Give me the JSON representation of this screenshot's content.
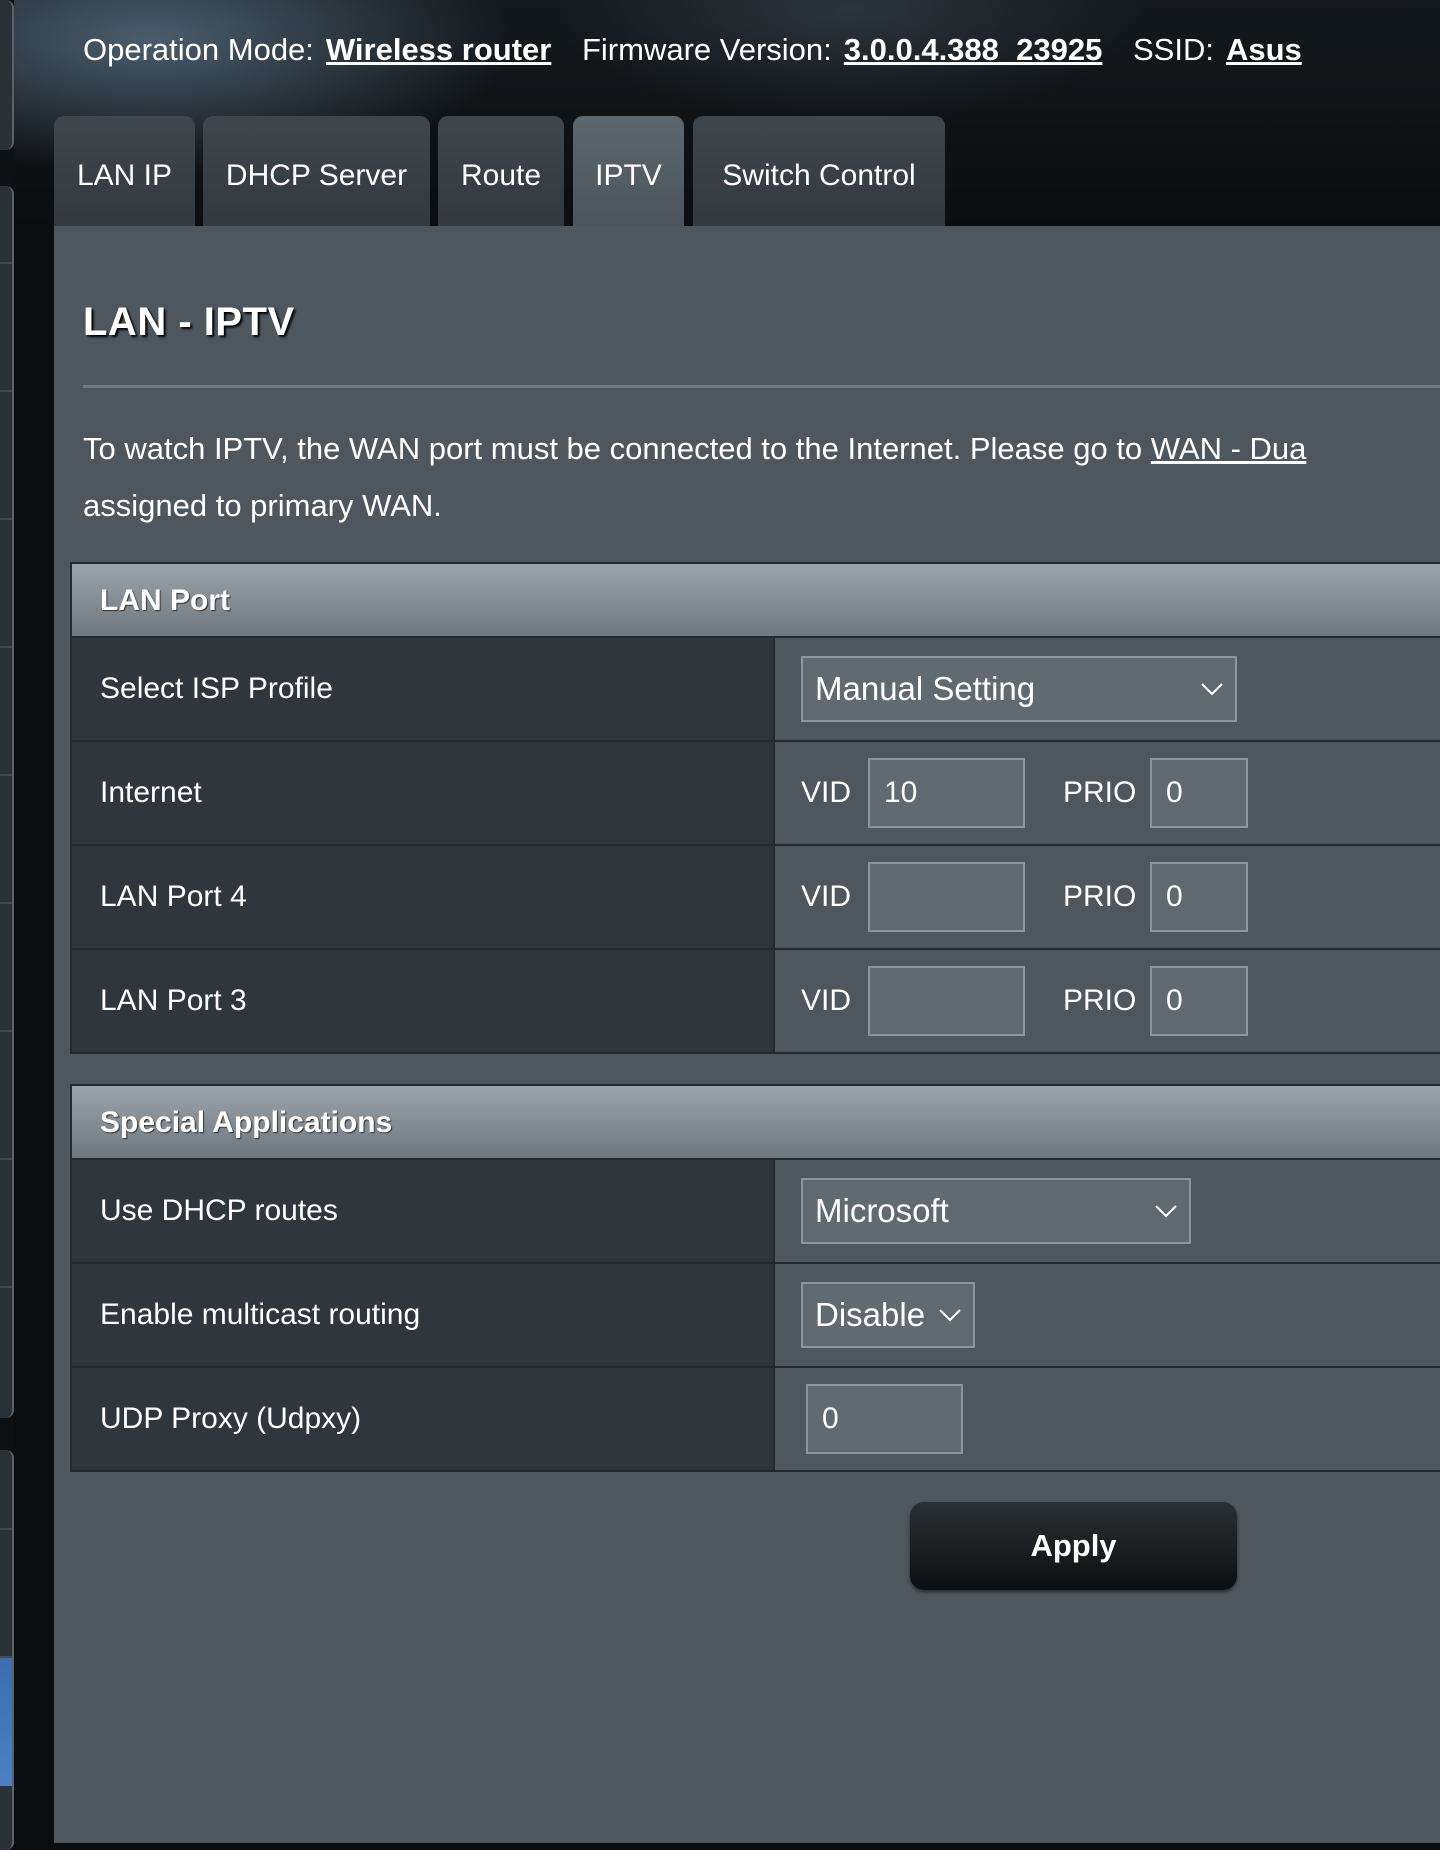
{
  "info_bar": {
    "operation_mode_label": "Operation Mode:",
    "operation_mode_value": "Wireless router",
    "firmware_label": "Firmware Version:",
    "firmware_value": "3.0.0.4.388_23925",
    "ssid_label": "SSID:",
    "ssid_value": "Asus"
  },
  "tabs": [
    {
      "label": "LAN IP",
      "active": false
    },
    {
      "label": "DHCP Server",
      "active": false
    },
    {
      "label": "Route",
      "active": false
    },
    {
      "label": "IPTV",
      "active": true
    },
    {
      "label": "Switch Control",
      "active": false
    }
  ],
  "page": {
    "title": "LAN - IPTV",
    "desc_line1_prefix": "To watch IPTV, the WAN port must be connected to the Internet. Please go to ",
    "desc_link": "WAN - Dua",
    "desc_line2": "assigned to primary WAN."
  },
  "lan_port": {
    "header": "LAN Port",
    "isp_profile_label": "Select ISP Profile",
    "isp_profile_value": "Manual Setting",
    "vid_label": "VID",
    "prio_label": "PRIO",
    "rows": [
      {
        "label": "Internet",
        "vid": "10",
        "prio": "0"
      },
      {
        "label": "LAN Port 4",
        "vid": "",
        "prio": "0"
      },
      {
        "label": "LAN Port 3",
        "vid": "",
        "prio": "0"
      }
    ]
  },
  "special": {
    "header": "Special Applications",
    "dhcp_routes_label": "Use DHCP routes",
    "dhcp_routes_value": "Microsoft",
    "multicast_label": "Enable multicast routing",
    "multicast_value": "Disable",
    "udpxy_label": "UDP Proxy (Udpxy)",
    "udpxy_value": "0"
  },
  "apply_label": "Apply",
  "colors": {
    "panel": "#4d575d",
    "label_cell": "#2f373c",
    "input_bg": "#5f6b71",
    "sidebar_accent": "#4d7fc4"
  },
  "icons": {
    "select_arrow": "chevron-down-icon"
  }
}
